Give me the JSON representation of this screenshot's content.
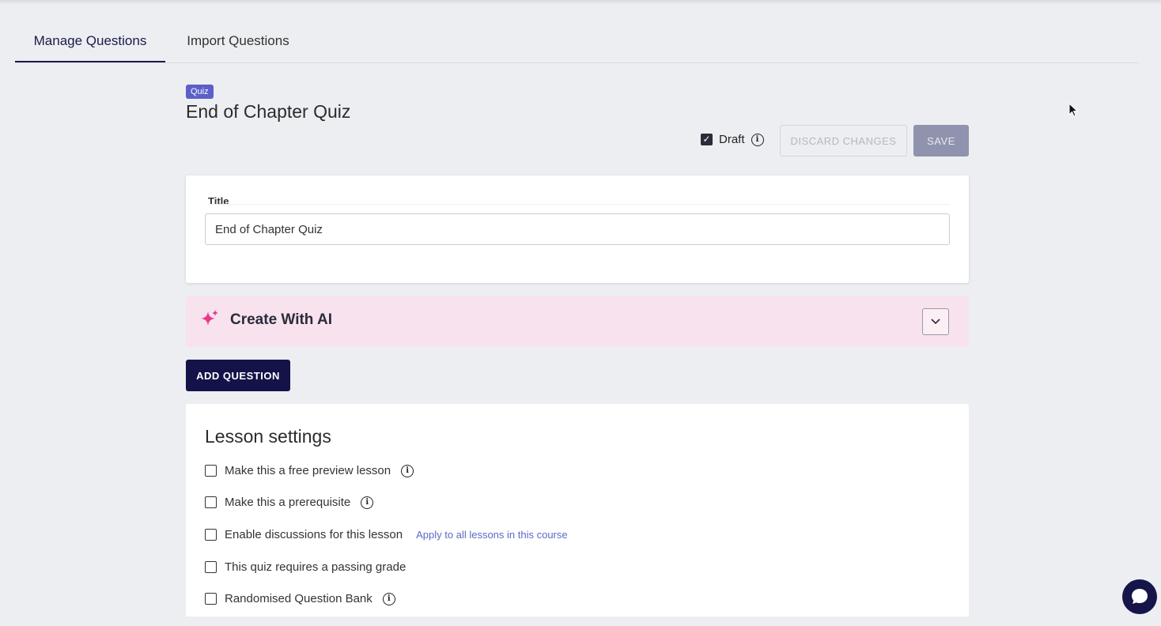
{
  "tabs": [
    {
      "label": "Manage Questions",
      "active": true
    },
    {
      "label": "Import Questions",
      "active": false
    }
  ],
  "header": {
    "badge": "Quiz",
    "title": "End of Chapter Quiz"
  },
  "actions": {
    "draft_label": "Draft",
    "draft_checked": true,
    "discard_label": "DISCARD CHANGES",
    "save_label": "SAVE"
  },
  "title_card": {
    "label": "Title",
    "value": "End of Chapter Quiz"
  },
  "ai_panel": {
    "label": "Create With AI",
    "icon": "sparkle-icon"
  },
  "add_question_label": "ADD QUESTION",
  "lesson_settings": {
    "heading": "Lesson settings",
    "options": [
      {
        "label": "Make this a free preview lesson",
        "checked": false,
        "info": true
      },
      {
        "label": "Make this a prerequisite",
        "checked": false,
        "info": true
      },
      {
        "label": "Enable discussions for this lesson",
        "checked": false,
        "info": false,
        "link": "Apply to all lessons in this course"
      },
      {
        "label": "This quiz requires a passing grade",
        "checked": false,
        "info": false
      },
      {
        "label": "Randomised Question Bank",
        "checked": false,
        "info": true
      }
    ]
  },
  "colors": {
    "primary": "#13134a",
    "badge": "#5b5fc7",
    "ai_background": "#f8e2ee",
    "ai_icon": "#e8388a",
    "link": "#5b6bc7"
  }
}
